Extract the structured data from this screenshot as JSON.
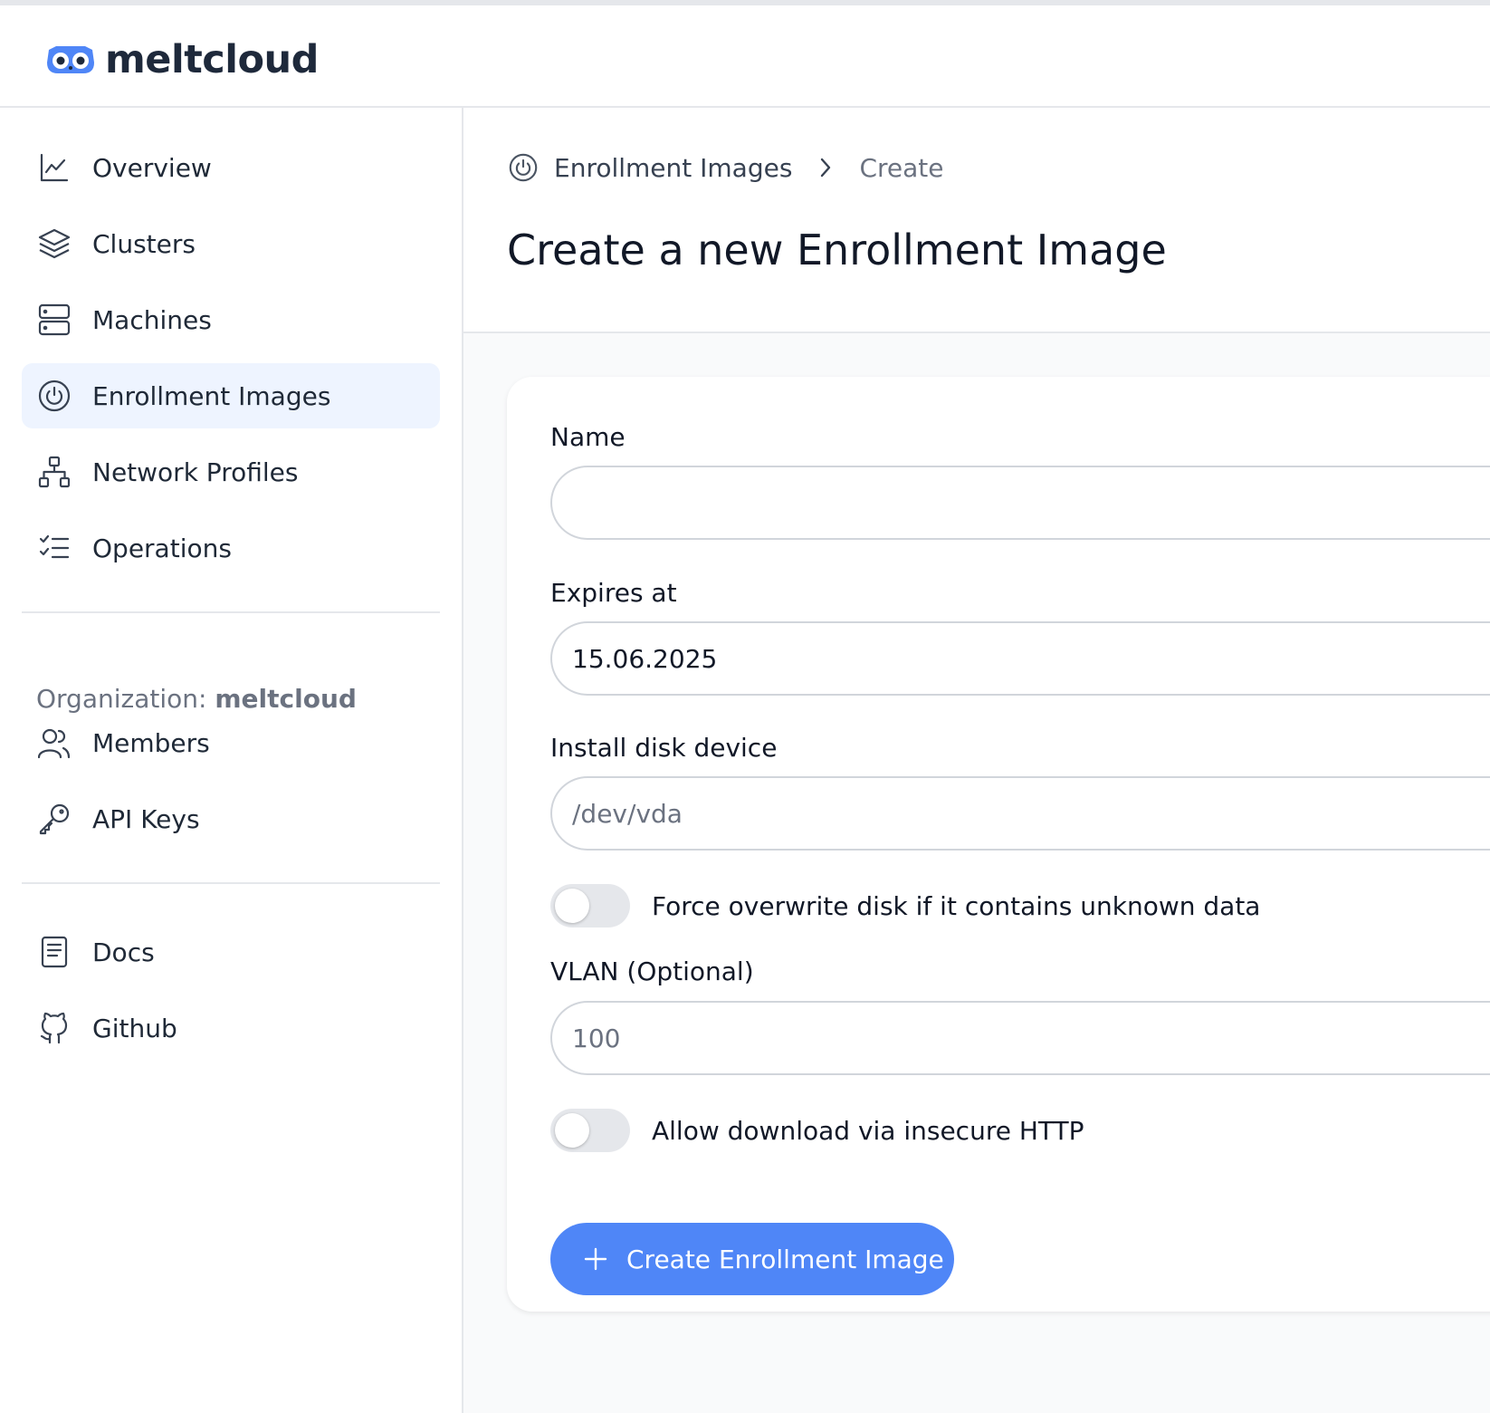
{
  "app": {
    "name": "meltcloud"
  },
  "sidebar": {
    "items": [
      {
        "label": "Overview",
        "icon": "chart-line-icon"
      },
      {
        "label": "Clusters",
        "icon": "layers-icon"
      },
      {
        "label": "Machines",
        "icon": "server-icon"
      },
      {
        "label": "Enrollment Images",
        "icon": "power-icon",
        "active": true
      },
      {
        "label": "Network Profiles",
        "icon": "network-icon"
      },
      {
        "label": "Operations",
        "icon": "checklist-icon"
      }
    ],
    "organization": {
      "prefix": "Organization:",
      "name": "meltcloud"
    },
    "org_items": [
      {
        "label": "Members",
        "icon": "users-icon"
      },
      {
        "label": "API Keys",
        "icon": "key-icon"
      }
    ],
    "footer_items": [
      {
        "label": "Docs",
        "icon": "document-icon"
      },
      {
        "label": "Github",
        "icon": "github-icon"
      }
    ]
  },
  "breadcrumb": {
    "parent": "Enrollment Images",
    "current": "Create"
  },
  "page": {
    "title": "Create a new Enrollment Image"
  },
  "form": {
    "name": {
      "label": "Name",
      "value": "",
      "placeholder": ""
    },
    "expires": {
      "label": "Expires at",
      "value": "15.06.2025"
    },
    "disk": {
      "label": "Install disk device",
      "placeholder": "/dev/vda"
    },
    "force_overwrite": {
      "label": "Force overwrite disk if it contains unknown data",
      "checked": false
    },
    "vlan": {
      "label": "VLAN (Optional)",
      "placeholder": "100"
    },
    "insecure_http": {
      "label": "Allow download via insecure HTTP",
      "checked": false
    },
    "submit_label": "Create Enrollment Image"
  },
  "colors": {
    "accent": "#4f86f7",
    "active_bg": "#eef4ff"
  }
}
